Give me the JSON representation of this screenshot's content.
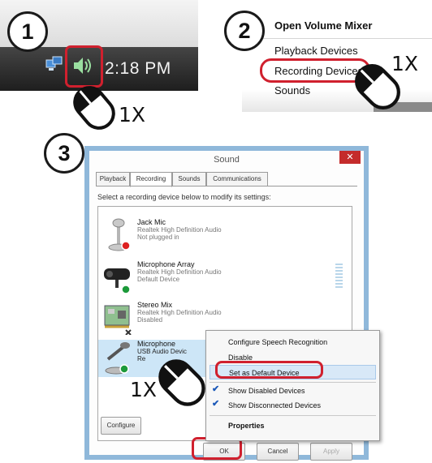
{
  "steps": {
    "one": "1",
    "two": "2",
    "three": "3"
  },
  "clicks": {
    "step1": "1X",
    "step2": "1X",
    "step3": "1X"
  },
  "taskbar": {
    "clock": "2:18 PM"
  },
  "context_menu": {
    "items": [
      "Open Volume Mixer",
      "Playback Devices",
      "Recording Devices",
      "Sounds"
    ]
  },
  "dialog": {
    "title": "Sound",
    "close_glyph": "✕",
    "tabs": [
      "Playback",
      "Recording",
      "Sounds",
      "Communications"
    ],
    "instruction": "Select a recording device below to modify its settings:",
    "devices": [
      {
        "name": "Jack Mic",
        "line1": "Realtek High Definition Audio",
        "line2": "Not plugged in"
      },
      {
        "name": "Microphone Array",
        "line1": "Realtek High Definition Audio",
        "line2": "Default Device"
      },
      {
        "name": "Stereo Mix",
        "line1": "Realtek High Definition Audio",
        "line2": "Disabled"
      },
      {
        "name": "Microphone",
        "line1": "USB Audio Devic",
        "line2": "Re"
      }
    ],
    "buttons": {
      "configure": "Configure",
      "ok": "OK",
      "cancel": "Cancel",
      "apply": "Apply"
    }
  },
  "popup": {
    "items": [
      "Configure Speech Recognition",
      "Disable",
      "Set as Default Device",
      "Show Disabled Devices",
      "Show Disconnected Devices",
      "Properties"
    ],
    "check": "✔"
  },
  "colors": {
    "highlight_red": "#d0202e",
    "selection_blue": "#cde6f7",
    "dialog_border": "#8fb8da"
  }
}
